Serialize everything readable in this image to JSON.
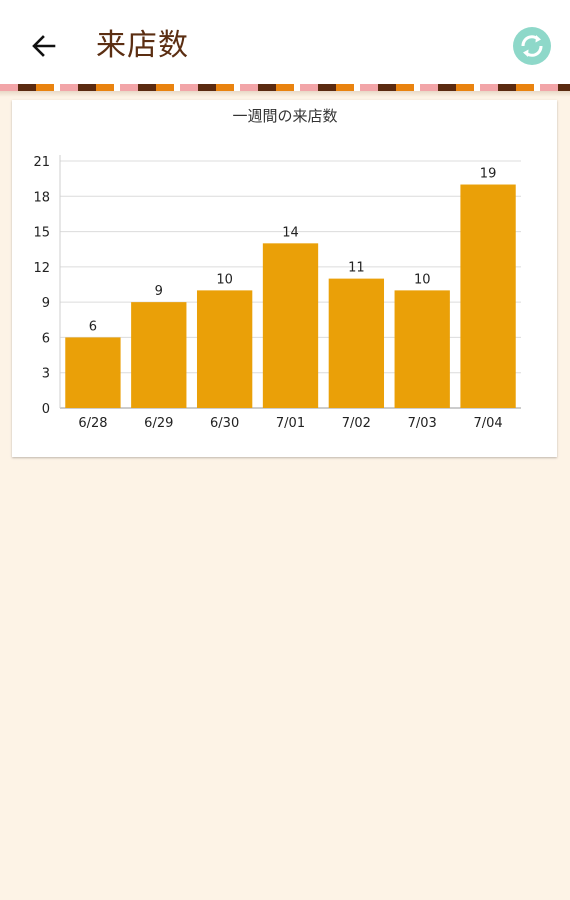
{
  "app_bar": {
    "title": "来店数",
    "back_icon": "arrow-left-icon",
    "refresh_icon": "refresh-icon",
    "accent": "#8ed8c9"
  },
  "chart_data": {
    "type": "bar",
    "title": "一週間の来店数",
    "categories": [
      "6/28",
      "6/29",
      "6/30",
      "7/01",
      "7/02",
      "7/03",
      "7/04"
    ],
    "values": [
      6,
      9,
      10,
      14,
      11,
      10,
      19
    ],
    "yticks": [
      "0",
      "3",
      "6",
      "9",
      "12",
      "15",
      "18",
      "21"
    ],
    "ylim": [
      0,
      21
    ],
    "xlabel": "",
    "ylabel": "",
    "grid": true,
    "bar_color": "#eaa008"
  }
}
